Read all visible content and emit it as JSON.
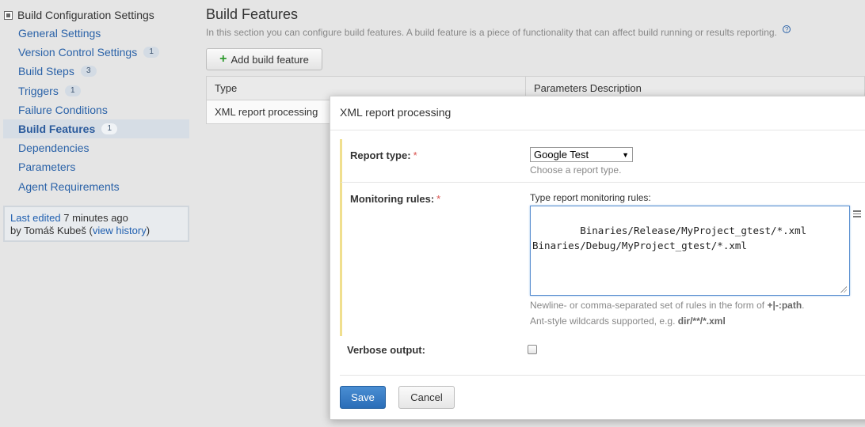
{
  "sidebar": {
    "header": "Build Configuration Settings",
    "items": [
      {
        "label": "General Settings",
        "badge": ""
      },
      {
        "label": "Version Control Settings",
        "badge": "1"
      },
      {
        "label": "Build Steps",
        "badge": "3"
      },
      {
        "label": "Triggers",
        "badge": "1"
      },
      {
        "label": "Failure Conditions",
        "badge": ""
      },
      {
        "label": "Build Features",
        "badge": "1",
        "active": true
      },
      {
        "label": "Dependencies",
        "badge": ""
      },
      {
        "label": "Parameters",
        "badge": ""
      },
      {
        "label": "Agent Requirements",
        "badge": ""
      }
    ],
    "last_edited_prefix": "Last edited",
    "last_edited_time": "7 minutes ago",
    "edited_by_prefix": "by Tomáš Kubeš (",
    "view_history": "view history",
    "edited_by_suffix": ")"
  },
  "main": {
    "title": "Build Features",
    "description": "In this section you can configure build features. A build feature is a piece of functionality that can affect build running or results reporting.",
    "help_glyph": "?",
    "add_button": "Add build feature",
    "table": {
      "headers": [
        "Type",
        "Parameters Description"
      ],
      "rows": [
        [
          "XML report processing",
          ""
        ]
      ]
    }
  },
  "dialog": {
    "title": "XML report processing",
    "report_type": {
      "label": "Report type:",
      "required_mark": "*",
      "selected": "Google Test",
      "note": "Choose a report type."
    },
    "monitoring": {
      "label": "Monitoring rules:",
      "required_mark": "*",
      "hint": "Type report monitoring rules:",
      "value": "Binaries/Release/MyProject_gtest/*.xml\nBinaries/Debug/MyProject_gtest/*.xml",
      "note1_prefix": "Newline- or comma-separated set of rules in the form of",
      "note1_code": "+|-:path",
      "note1_suffix": ".",
      "note2_prefix": "Ant-style wildcards supported, e.g.",
      "note2_code": "dir/**/*.xml"
    },
    "verbose": {
      "label": "Verbose output:",
      "checked": false
    },
    "save_button": "Save",
    "cancel_button": "Cancel"
  },
  "colors": {
    "link": "#2a62a8",
    "primary_button": "#2a6db8",
    "required": "#d9534f",
    "highlight_border": "#f0df8e"
  }
}
